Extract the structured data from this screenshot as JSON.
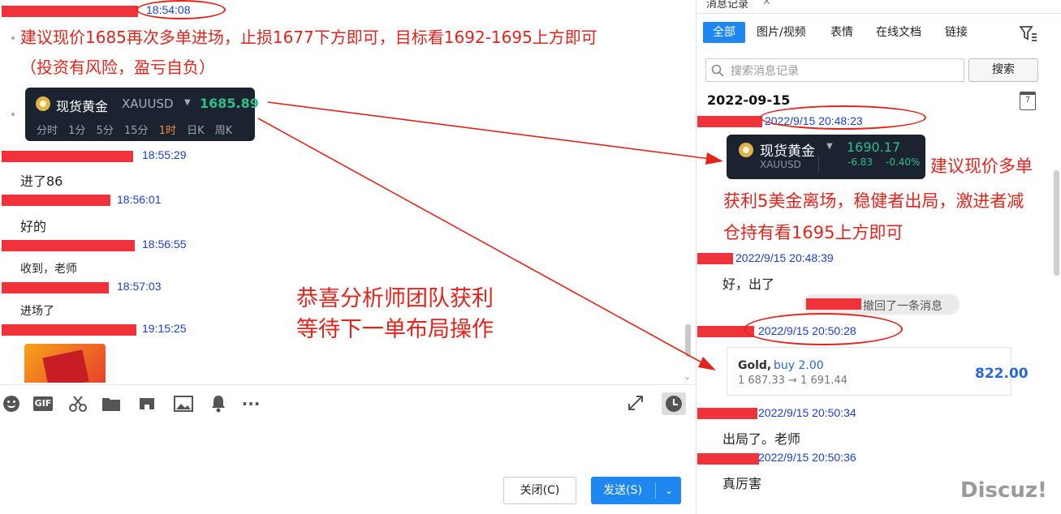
{
  "left": {
    "messages": [
      {
        "time": "18:54:08"
      },
      {
        "time": "18:55:29",
        "text": "进了86"
      },
      {
        "time": "18:56:01",
        "text": "好的"
      },
      {
        "time": "18:56:55",
        "text": "收到，老师"
      },
      {
        "time": "18:57:03",
        "text": "进场了"
      },
      {
        "time": "19:15:25"
      }
    ],
    "advice_line1": "建议现价1685再次多单进场，止损1677下方即可，目标看1692-1695上方即可",
    "advice_line2": "（投资有风险，盈亏自负）",
    "quote_card": {
      "name": "现货黄金",
      "symbol": "XAUUSD",
      "price": "1685.89",
      "intervals": [
        "分时",
        "1分",
        "5分",
        "15分",
        "1时",
        "日K",
        "周K"
      ]
    },
    "congrats_line1": "恭喜分析师团队获利",
    "congrats_line2": "等待下一单布局操作",
    "close_label": "关闭(C)",
    "send_label": "发送(S)"
  },
  "right": {
    "header_title": "消息记录",
    "tabs": [
      "全部",
      "图片/视频",
      "表情",
      "在线文档",
      "链接"
    ],
    "search_placeholder": "搜索消息记录",
    "search_button": "搜索",
    "date": "2022-09-15",
    "calendar_day": "7",
    "quote_card": {
      "name": "现货黄金",
      "symbol": "XAUUSD",
      "price": "1690.17",
      "change": "-6.83",
      "change_pct": "-0.40%"
    },
    "advice": [
      "建议现价多单",
      "获利5美金离场，稳健者出局，激进者减",
      "仓持有看1695上方即可"
    ],
    "entries": [
      {
        "time": "2022/9/15 20:48:23"
      },
      {
        "time": "2022/9/15 20:48:39",
        "text": "好，出了"
      },
      {
        "time": "2022/9/15 20:50:28"
      },
      {
        "time": "2022/9/15 20:50:34",
        "text": "出局了。老师"
      },
      {
        "time": "2022/9/15 20:50:36",
        "text": "真厉害"
      }
    ],
    "recall_notice": "撤回了一条消息",
    "trade": {
      "instrument": "Gold,",
      "side": "buy 2.00",
      "prices": "1 687.33 → 1 691.44",
      "profit": "822.00"
    }
  },
  "watermark": "Discuz!",
  "accent_color": "#1e88f0",
  "annotation_color": "#e4231b"
}
